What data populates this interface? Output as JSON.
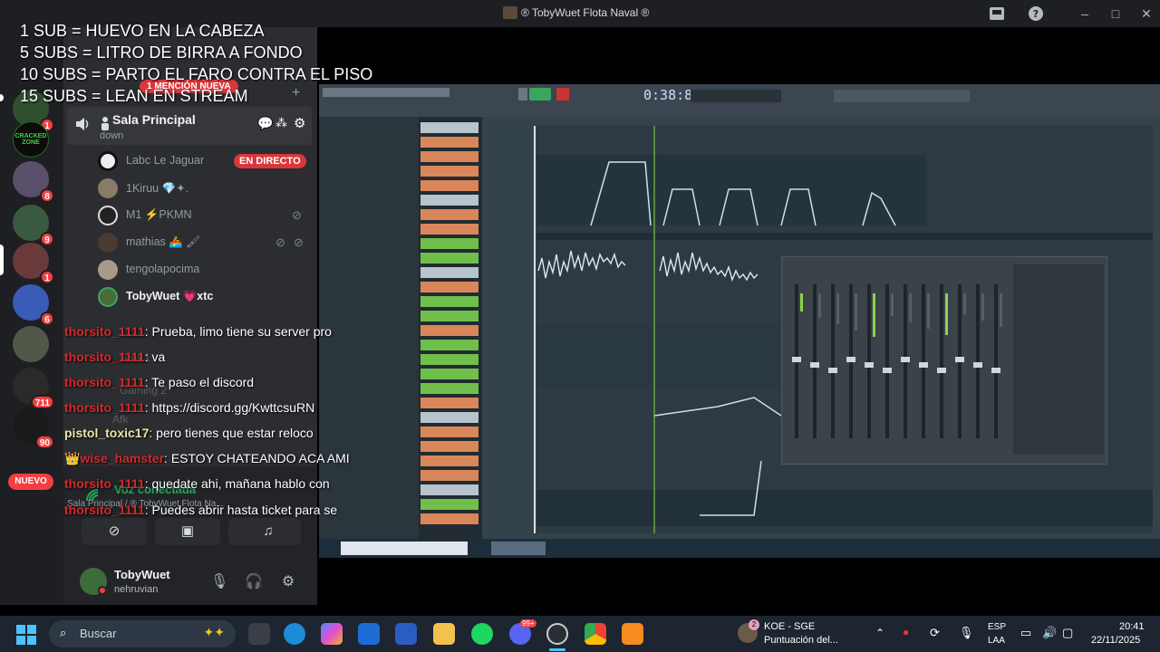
{
  "window": {
    "title": "® TobyWuet Flota Naval ®"
  },
  "overlay": {
    "lines": [
      "1 SUB = HUEVO EN LA CABEZA",
      "5 SUBS = LITRO DE BIRRA A FONDO",
      "10 SUBS = PARTO EL FARO CONTRA EL PISO",
      "15 SUBS = LEAN EN STREAM"
    ]
  },
  "rail": {
    "badges": [
      "1",
      "8",
      "9",
      "1",
      "6",
      "711",
      "90"
    ],
    "new_label": "NUEVO",
    "server_label": "CRACKED ZONE"
  },
  "channel": {
    "mention_banner": "1 MENCIÓN NUEVA",
    "voice_channel": "Sala Principal",
    "voice_sub": "down",
    "live_label": "EN DIRECTO",
    "users": [
      {
        "name": "Labc Le Jaguar"
      },
      {
        "name": "1Kiruu 💎✦."
      },
      {
        "name": "M1 ⚡PKMN"
      },
      {
        "name": "mathias 🚣 🖌"
      },
      {
        "name": "tengolapocima"
      },
      {
        "name": "TobyWuet 💗xtc"
      }
    ],
    "faded_channels": [
      "Sala 1",
      "Gaming 2",
      "Afk"
    ]
  },
  "voice": {
    "status": "Voz conectada",
    "location": "Sala Principal / ® TobyWuet Flota Na..."
  },
  "user": {
    "name": "TobyWuet",
    "status": "nehruvian"
  },
  "chat": [
    {
      "user": "thorsito_1111",
      "msg": "Prueba, limo tiene su server pro",
      "style": "red"
    },
    {
      "user": "thorsito_1111",
      "msg": "va",
      "style": "red"
    },
    {
      "user": "thorsito_1111",
      "msg": "Te paso el discord",
      "style": "red"
    },
    {
      "user": "thorsito_1111",
      "msg": "https://discord.gg/KwttcsuRN",
      "style": "red"
    },
    {
      "user": "pistol_toxic17",
      "msg": "pero tienes que estar reloco",
      "style": "yellow"
    },
    {
      "user": "👑wise_hamster",
      "msg": "ESTOY CHATEANDO ACA AMI",
      "style": "red"
    },
    {
      "user": "thorsito_1111",
      "msg": "quedate ahi, mañana hablo con",
      "style": "red"
    },
    {
      "user": "thorsito_1111",
      "msg": "Puedes abrir hasta ticket para se",
      "style": "red"
    }
  ],
  "fl": {
    "time": "0:38:8"
  },
  "taskbar": {
    "search_label": "Buscar",
    "notif_title": "KOE - SGE",
    "notif_sub": "Puntuación del...",
    "notif_badge": "2",
    "lang_top": "ESP",
    "lang_bottom": "LAA",
    "time": "20:41",
    "date": "22/11/2025",
    "discord_badge": "99+"
  }
}
